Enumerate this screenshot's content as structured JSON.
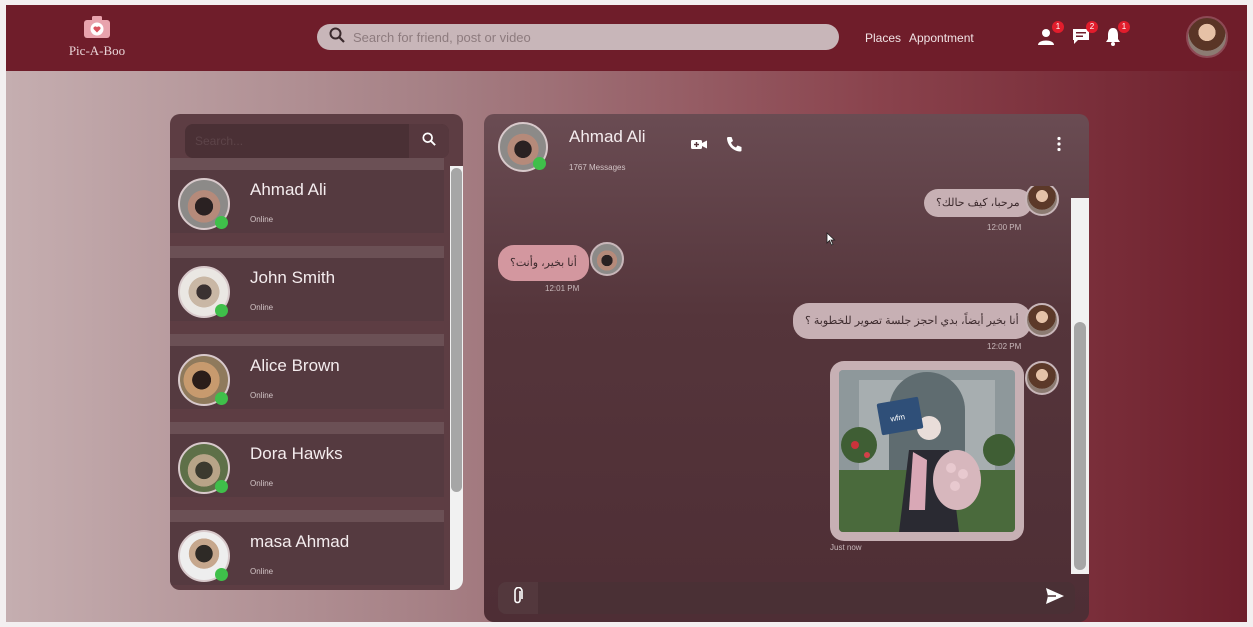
{
  "app": {
    "name": "Pic-A-Boo"
  },
  "topbar": {
    "search_placeholder": "Search for friend, post or video",
    "nav": [
      "Places",
      "Appontment"
    ],
    "badges": {
      "friends": "1",
      "messages": "2",
      "notifications": "1"
    }
  },
  "contacts": {
    "search_placeholder": "Search...",
    "items": [
      {
        "name": "Ahmad Ali",
        "status": "Online"
      },
      {
        "name": "John Smith",
        "status": "Online"
      },
      {
        "name": "Alice Brown",
        "status": "Online"
      },
      {
        "name": "Dora Hawks",
        "status": "Online"
      },
      {
        "name": "masa Ahmad",
        "status": "Online"
      }
    ]
  },
  "chat": {
    "name": "Ahmad Ali",
    "message_count": "1767 Messages",
    "messages": [
      {
        "text": "مرحبا، كيف حالك؟",
        "time": "12:00 PM",
        "dir": "out"
      },
      {
        "text": "أنا بخير، وأنت؟",
        "time": "12:01 PM",
        "dir": "in"
      },
      {
        "text": "أنا بخير أيضاً، بدي احجز جلسة تصوير للخطوبة ؟",
        "time": "12:02 PM",
        "dir": "out"
      },
      {
        "type": "image",
        "time": "Just now",
        "dir": "out"
      }
    ]
  },
  "colors": {
    "topbar": "#6f1d2a",
    "accent": "#e11d2c",
    "online": "#3fbf4a"
  }
}
